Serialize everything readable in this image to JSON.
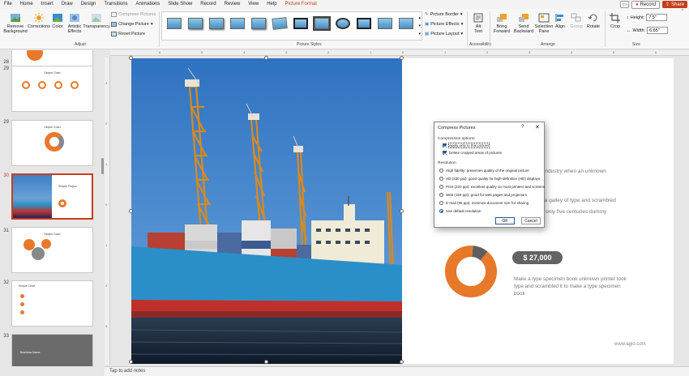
{
  "menu": {
    "tabs": [
      "File",
      "Home",
      "Insert",
      "Draw",
      "Design",
      "Transitions",
      "Animations",
      "Slide Show",
      "Record",
      "Review",
      "View",
      "Help",
      "Picture Format"
    ],
    "active_tab": "Picture Format",
    "record_label": "Record",
    "share_label": "Share"
  },
  "ribbon": {
    "adjust": {
      "remove_background": "Remove\nBackground",
      "corrections": "Corrections",
      "color": "Color",
      "artistic_effects": "Artistic\nEffects",
      "transparency": "Transparency",
      "compress_pictures": "Compress Pictures",
      "change_picture": "Change Picture",
      "reset_picture": "Reset Picture",
      "label": "Adjust"
    },
    "picture_styles": {
      "label": "Picture Styles",
      "picture_border": "Picture Border",
      "picture_effects": "Picture Effects",
      "picture_layout": "Picture Layout"
    },
    "accessibility": {
      "alt_text": "Alt\nText",
      "label": "Accessibility"
    },
    "arrange": {
      "bring_forward": "Bring\nForward",
      "send_backward": "Send\nBackward",
      "selection_pane": "Selection\nPane",
      "align": "Align",
      "group": "Group",
      "rotate": "Rotate",
      "label": "Arrange"
    },
    "size": {
      "crop": "Crop",
      "height_label": "Height:",
      "height_value": "7.5\"",
      "width_label": "Width:",
      "width_value": "6.65\"",
      "label": "Size"
    }
  },
  "slides": [
    {
      "number": "28",
      "title": ""
    },
    {
      "number": "29",
      "title": "Simple Chart"
    },
    {
      "number": "29",
      "title": "Simple Chart"
    },
    {
      "number": "30",
      "title": "Simple Project"
    },
    {
      "number": "31",
      "title": "Simple Chart"
    },
    {
      "number": "32",
      "title": "Simple Chart"
    },
    {
      "number": "33",
      "title": "Business Name"
    }
  ],
  "ruler_h": [
    "6",
    "5",
    "4",
    "3",
    "2",
    "1",
    "0",
    "1",
    "2",
    "3",
    "4",
    "5",
    "6"
  ],
  "ruler_v": [
    "3",
    "2",
    "1",
    "0",
    "1",
    "2",
    "3"
  ],
  "slide": {
    "text_1": "setting industry when an unknown",
    "text_2": "er took a galley of type and scrambled",
    "text_3": "ved not only five centuries dummy",
    "price": "$ 27,000",
    "description": "Make a type specimen book unknown printer took type and scrambled it to make a type specimen book",
    "site": "www.agio.com"
  },
  "chart_data": {
    "type": "pie",
    "title": "",
    "values": [
      90,
      10
    ],
    "colors": [
      "#e8792a",
      "#5f5f5f"
    ]
  },
  "dialog": {
    "title": "Compress Pictures",
    "help": "?",
    "close": "✕",
    "compression_options_label": "Compression options:",
    "apply_only": "Apply only to this picture",
    "delete_cropped": "Delete cropped areas of pictures",
    "resolution_label": "Resolution",
    "options": [
      "High fidelity: preserves quality of the original picture",
      "HD (330 ppi): good quality for high-definition (HD) displays",
      "Print (220 ppi): excellent quality on most printers and screens",
      "Web (150 ppi): good for web pages and projectors",
      "E-mail (96 ppi): minimize document size for sharing",
      "Use default resolution"
    ],
    "ok": "OK",
    "cancel": "Cancel"
  },
  "notes": {
    "placeholder": "Tap to add notes"
  },
  "colors": {
    "accent": "#c43e1c",
    "orange": "#e8792a",
    "badge": "#636363"
  }
}
